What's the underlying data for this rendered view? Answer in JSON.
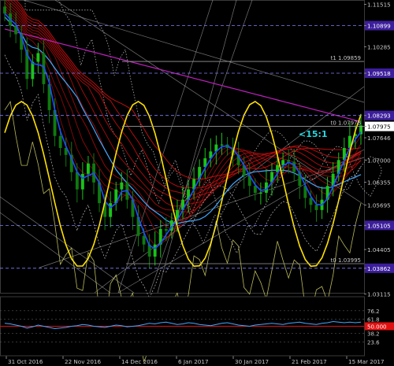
{
  "colors": {
    "background": "#000000",
    "axis_text": "#c8c8c8",
    "grid": "#1c2a3a",
    "candle_up": "#19c419",
    "candle_down": "#0f7a0f",
    "ma_fast": "#1f4fff",
    "ma_mid": "#3fa9ff",
    "ma_ribbon": "#d10f0f",
    "ma_slow": "#c020c0",
    "sine": "#ffe000",
    "oscillator_price": "#e8e870",
    "trendline": "#c0c0c0",
    "level_line": "#8080ff",
    "label_bg": "#3c1e9c",
    "label_text": "#ffffff",
    "annotation": "#28d7e0",
    "red_level": "#e01010"
  },
  "chart_data": [
    {
      "type": "line",
      "title": "",
      "xlabel": "",
      "ylabel": "",
      "ylim": [
        1.0315,
        1.1155
      ],
      "grid": false,
      "x_tick_labels": [
        "31 Oct 2016",
        "22 Nov 2016",
        "14 Dec 2016",
        "6 Jan 2017",
        "30 Jan 2017",
        "21 Feb 2017",
        "15 Mar 2017"
      ],
      "y_tick_labels": [
        "1.11515",
        "1.10899",
        "1.10285",
        "1.09518",
        "1.08293",
        "1.07975",
        "1.07646",
        "1.07000",
        "1.06355",
        "1.05695",
        "1.05105",
        "1.04405",
        "1.03862",
        "1.03115"
      ],
      "current_price_label": "1.07975",
      "highlighted_levels": [
        {
          "value": 1.10899,
          "label": "1.10899"
        },
        {
          "value": 1.09518,
          "label": "1.09518"
        },
        {
          "value": 1.08293,
          "label": "1.08293"
        },
        {
          "value": 1.05105,
          "label": "1.05105"
        },
        {
          "value": 1.03862,
          "label": "1.03862"
        }
      ],
      "annotated_levels": [
        {
          "value": 1.09859,
          "label": "t1 1.09859"
        },
        {
          "value": 1.07976,
          "label": "t0 1.07976"
        },
        {
          "value": 1.03995,
          "label": "t0 1.03995"
        }
      ],
      "annotation": "<15:1",
      "series": [
        {
          "values": [
            1.1125,
            1.109,
            1.1065,
            1.102,
            1.0935,
            1.0985,
            1.101,
            1.092,
            1.0845,
            1.077,
            1.0735,
            1.0715,
            1.0665,
            1.0615,
            1.066,
            1.069,
            1.0635,
            1.0575,
            1.0535,
            1.0575,
            1.0615,
            1.0635,
            1.0585,
            1.0535,
            1.048,
            1.0455,
            1.042,
            1.0455,
            1.05,
            1.0495,
            1.0525,
            1.0555,
            1.0585,
            1.0615,
            1.0645,
            1.068,
            1.0705,
            1.0725,
            1.0745,
            1.0745,
            1.0735,
            1.0715,
            1.0685,
            1.0655,
            1.0625,
            1.0605,
            1.0605,
            1.0635,
            1.0665,
            1.0685,
            1.07,
            1.0695,
            1.0665,
            1.0625,
            1.059,
            1.057,
            1.0555,
            1.0585,
            1.0625,
            1.066,
            1.07,
            1.0735,
            1.077,
            1.0775,
            1.08
          ]
        }
      ]
    },
    {
      "type": "line",
      "title": "",
      "ylim": [
        0,
        100
      ],
      "y_tick_labels": [
        "76.2",
        "61.8",
        "50.000",
        "38.2",
        "23.6"
      ],
      "highlighted_level": {
        "value": 50.0,
        "label": "50.000"
      },
      "series": [
        {
          "values": [
            55,
            54,
            52,
            50,
            47,
            49,
            52,
            50,
            48,
            46,
            47,
            48,
            50,
            51,
            53,
            52,
            50,
            49,
            48,
            50,
            52,
            51,
            49,
            50,
            51,
            53,
            55,
            54,
            56,
            57,
            55,
            53,
            54,
            56,
            55,
            53,
            52,
            51,
            53,
            55,
            56,
            54,
            52,
            51,
            50,
            52,
            53,
            54,
            55,
            54,
            53,
            55,
            56,
            57,
            55,
            54,
            53,
            55,
            56,
            58,
            57,
            56,
            57,
            56,
            57
          ]
        }
      ]
    }
  ]
}
